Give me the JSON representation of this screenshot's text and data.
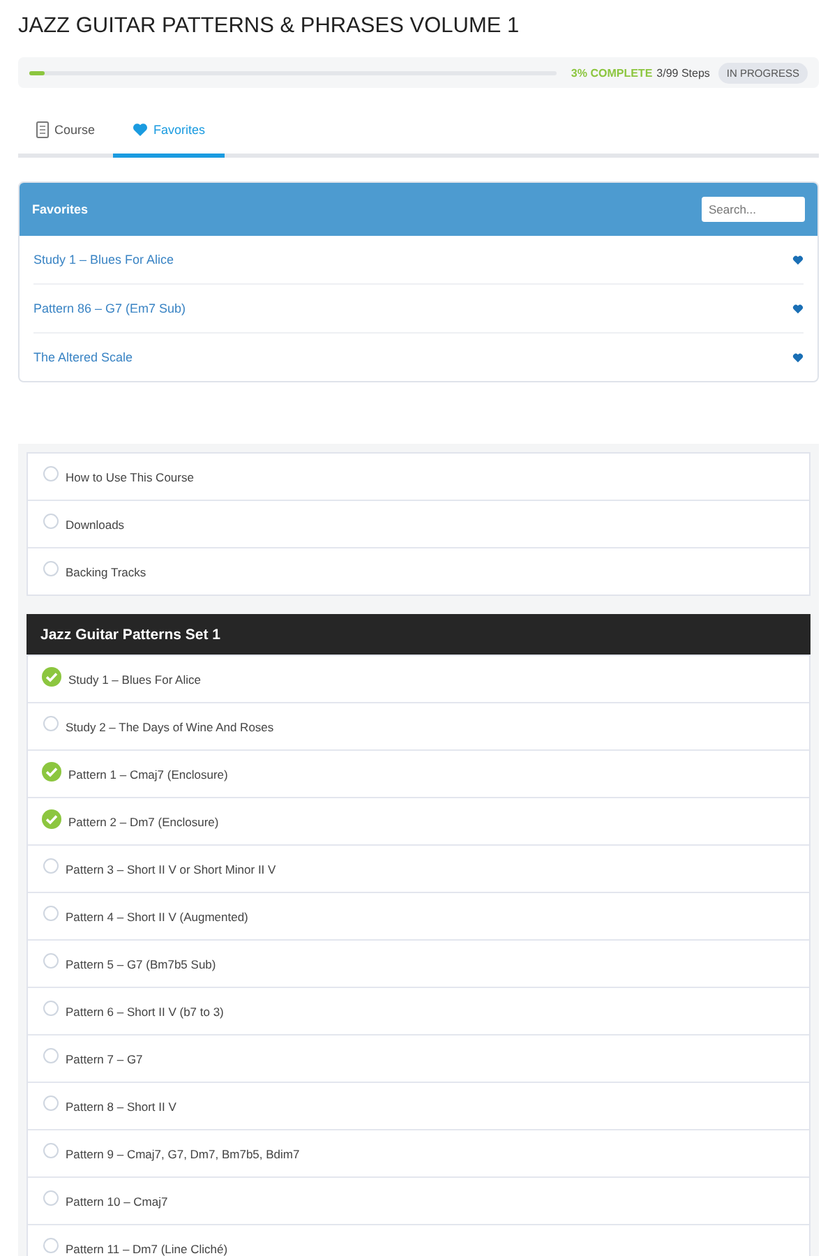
{
  "title": "JAZZ GUITAR PATTERNS & PHRASES VOLUME 1",
  "progress": {
    "level": 0.03,
    "percent_text": "3% COMPLETE",
    "steps_text": "3/99 Steps",
    "status": "IN PROGRESS"
  },
  "tabs": [
    {
      "label": "Course",
      "kind": "document",
      "selected": false
    },
    {
      "label": "Favorites",
      "kind": "heart",
      "selected": true
    }
  ],
  "favorites": {
    "title": "Favorites",
    "search": {
      "placeholder": "Search..."
    },
    "items": [
      {
        "label": "Study 1 – Blues For Alice"
      },
      {
        "label": "Pattern 86 – G7 (Em7 Sub)"
      },
      {
        "label": "The Altered Scale"
      }
    ]
  },
  "intro_lessons": [
    {
      "label": "How to Use This Course",
      "completed": false
    },
    {
      "label": "Downloads",
      "completed": false
    },
    {
      "label": "Backing Tracks",
      "completed": false
    }
  ],
  "section": {
    "title": "Jazz Guitar Patterns Set 1",
    "lessons": [
      {
        "label": "Study 1 – Blues For Alice",
        "completed": true
      },
      {
        "label": "Study 2 – The Days of Wine And Roses",
        "completed": false
      },
      {
        "label": "Pattern 1 – Cmaj7 (Enclosure)",
        "completed": true
      },
      {
        "label": "Pattern 2 – Dm7 (Enclosure)",
        "completed": true
      },
      {
        "label": "Pattern 3 – Short II V or Short Minor II V",
        "completed": false
      },
      {
        "label": "Pattern 4 – Short II V (Augmented)",
        "completed": false
      },
      {
        "label": "Pattern 5 – G7 (Bm7b5 Sub)",
        "completed": false
      },
      {
        "label": "Pattern 6 – Short II V (b7 to 3)",
        "completed": false
      },
      {
        "label": "Pattern 7 – G7",
        "completed": false
      },
      {
        "label": "Pattern 8 – Short II V",
        "completed": false
      },
      {
        "label": "Pattern 9 – Cmaj7, G7, Dm7, Bm7b5, Bdim7",
        "completed": false
      },
      {
        "label": "Pattern 10 – Cmaj7",
        "completed": false
      },
      {
        "label": "Pattern 11 – Dm7 (Line Cliché)",
        "completed": false
      }
    ]
  }
}
